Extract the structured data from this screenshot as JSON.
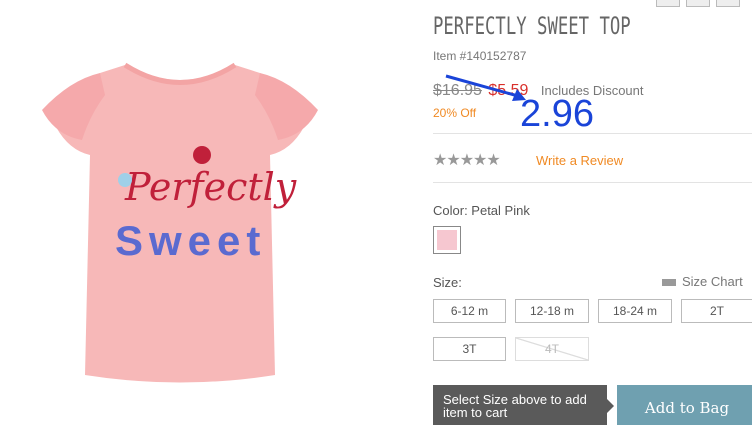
{
  "product": {
    "title": "PERFECTLY SWEET TOP",
    "item_number": "Item #140152787",
    "old_price": "$16.95",
    "new_price": "$5.59",
    "discount_note": "Includes Discount",
    "percent_off": "20% Off",
    "review_link": "Write a Review",
    "rating_stars": "★★★★★",
    "image_alt": "pink ruffle sleeve top",
    "graphic_text_line1": "Perfectly",
    "graphic_text_line2": "Sweet"
  },
  "annotation": {
    "value": "2.96",
    "color": "#1a44d8"
  },
  "color": {
    "label": "Color: Petal Pink",
    "swatch_color": "#f6c7d0"
  },
  "sizes": {
    "label": "Size:",
    "chart_label": "Size Chart",
    "options": [
      {
        "label": "6-12 m",
        "available": true
      },
      {
        "label": "12-18 m",
        "available": true
      },
      {
        "label": "18-24 m",
        "available": true
      },
      {
        "label": "2T",
        "available": true
      },
      {
        "label": "3T",
        "available": true
      },
      {
        "label": "4T",
        "available": false
      }
    ]
  },
  "cart": {
    "select_note": "Select Size above to add item to cart",
    "add_button": "Add to Bag"
  },
  "colors": {
    "price_red": "#d9302b",
    "accent_orange": "#f08a24",
    "button_teal": "#6fa0b0"
  }
}
